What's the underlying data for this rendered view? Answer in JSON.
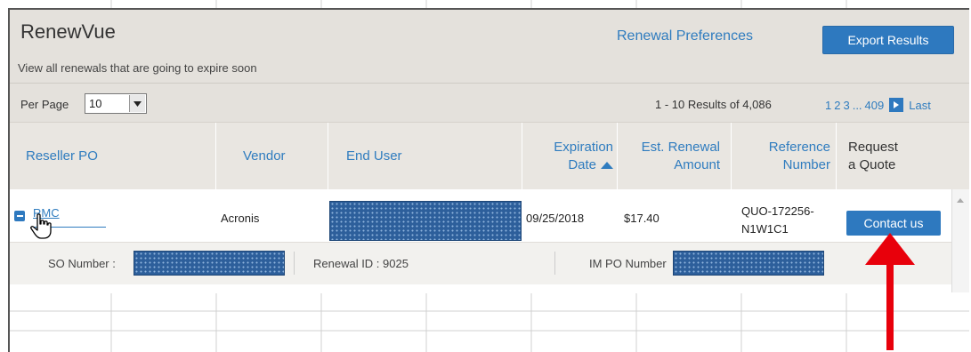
{
  "app": {
    "title": "RenewVue",
    "subtitle": "View all renewals that are going to expire soon",
    "renewal_preferences_link": "Renewal Preferences",
    "export_button": "Export Results"
  },
  "controls": {
    "per_page_label": "Per Page",
    "per_page_value": "10",
    "results_text": "1 - 10 Results of 4,086",
    "pager": {
      "pages": [
        "1",
        "2",
        "3"
      ],
      "ellipsis": "...",
      "last_page": "409",
      "last_label": "Last"
    }
  },
  "columns": {
    "reseller_po": "Reseller PO",
    "vendor": "Vendor",
    "end_user": "End User",
    "expiration_line1": "Expiration",
    "expiration_line2": "Date",
    "renewal_line1": "Est. Renewal",
    "renewal_line2": "Amount",
    "reference_line1": "Reference",
    "reference_line2": "Number",
    "quote_line1": "Request",
    "quote_line2": "a Quote"
  },
  "row": {
    "reseller_po": "RMC",
    "vendor": "Acronis",
    "expiration_date": "09/25/2018",
    "renewal_amount": "$17.40",
    "reference_line1": "QUO-172256-",
    "reference_line2": "N1W1C1",
    "contact_button": "Contact us"
  },
  "detail": {
    "so_number_label": "SO Number :",
    "renewal_id_text": "Renewal ID : 9025",
    "im_po_label": "IM PO Number"
  },
  "colors": {
    "accent": "#2e79bf",
    "link": "#2f7cbf",
    "header_bg": "#e4e1dc",
    "arrow": "#e8000b"
  }
}
